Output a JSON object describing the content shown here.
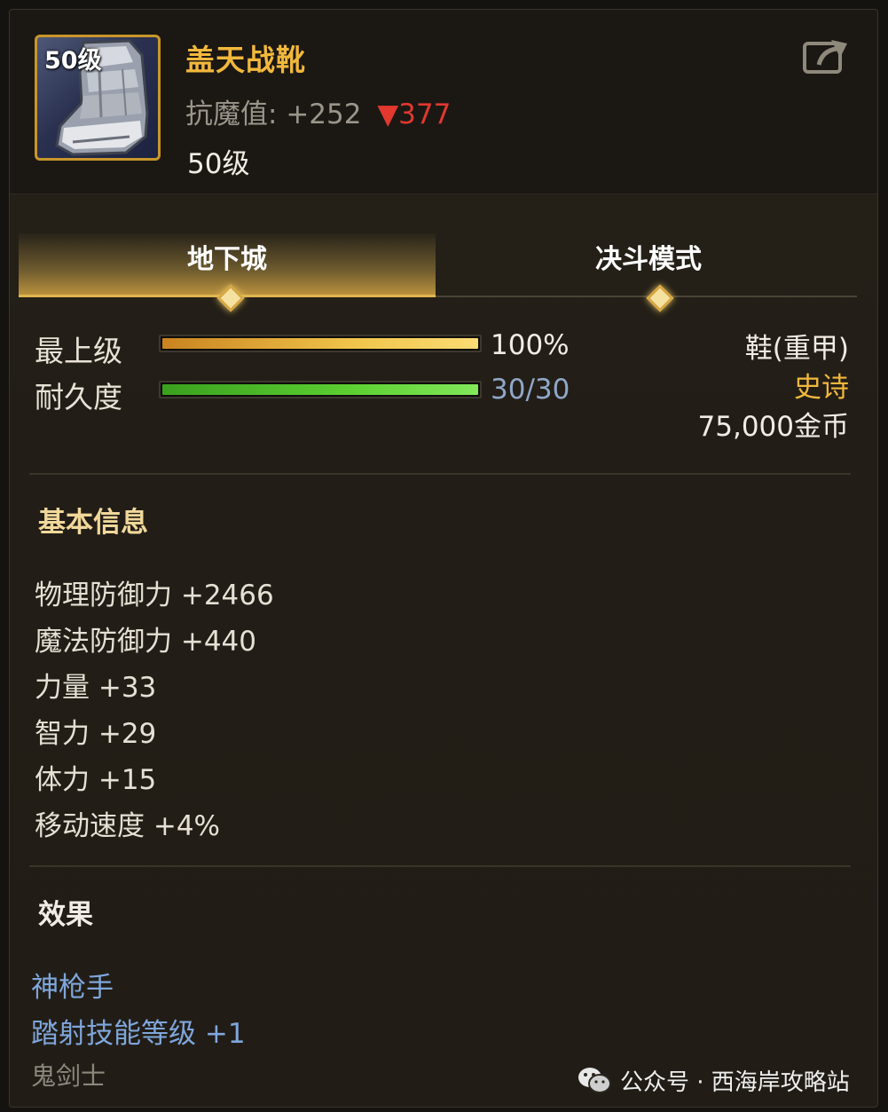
{
  "item": {
    "icon_level": "50级",
    "name": "盖天战靴",
    "stat_label": "抗魔值:",
    "stat_value": "+252",
    "stat_delta": "▼377",
    "level": "50级"
  },
  "tabs": [
    {
      "label": "地下城",
      "active": true
    },
    {
      "label": "决斗模式",
      "active": false
    }
  ],
  "bars": {
    "top_grade": {
      "label": "最上级",
      "value": "100%",
      "fill_fraction": 1.0
    },
    "durability": {
      "label": "耐久度",
      "value": "30/30",
      "fill_fraction": 1.0
    }
  },
  "right_info": {
    "type": "鞋(重甲)",
    "rarity": "史诗",
    "price": "75,000金币"
  },
  "basic_info": {
    "title": "基本信息",
    "attributes": [
      "物理防御力 +2466",
      "魔法防御力 +440",
      "力量 +33",
      "智力 +29",
      "体力 +15",
      "移动速度 +4%"
    ]
  },
  "effects": {
    "title": "效果",
    "items": [
      "神枪手",
      "踏射技能等级 +1",
      "鬼剑士"
    ]
  },
  "watermark": {
    "text": "公众号 · 西海岸攻略站",
    "icon": "wechat-icon"
  },
  "colors": {
    "accent_gold": "#f2b83c",
    "rarity_epic": "#f2b83c",
    "delta_red": "#e2382e",
    "effect_blue": "#7fa6dc",
    "durability_value": "#8fa7c8"
  }
}
